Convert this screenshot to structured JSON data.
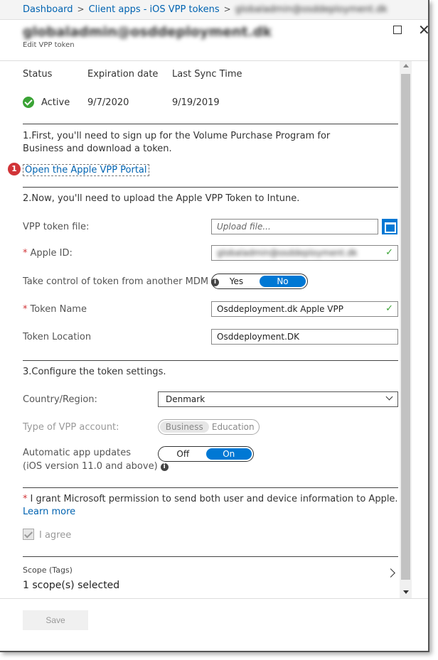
{
  "breadcrumb": {
    "items": [
      "Dashboard",
      "Client apps - iOS VPP tokens",
      "globaladmin@osddeployment.dk"
    ]
  },
  "header": {
    "title": "globaladmin@osddeployment.dk",
    "subtitle": "Edit VPP token"
  },
  "status_table": {
    "headers": [
      "Status",
      "Expiration date",
      "Last Sync Time"
    ],
    "status": "Active",
    "expiration": "9/7/2020",
    "last_sync": "9/19/2019"
  },
  "step1": {
    "text": "1.First, you'll need to sign up for the Volume Purchase Program for Business and download a token.",
    "badge": "1",
    "link": "Open the Apple VPP Portal"
  },
  "step2": {
    "text": "2.Now, you'll need to upload the Apple VPP Token to Intune.",
    "token_file_label": "VPP token file:",
    "token_file_placeholder": "Upload file...",
    "apple_id_label": "Apple ID:",
    "apple_id_value": "globaladmin@osddeployment.dk",
    "apple_id_visible_suffix": "dk",
    "take_control_label": "Take control of token from another MDM",
    "take_control_options": [
      "Yes",
      "No"
    ],
    "take_control_selected": "No",
    "token_name_label": "Token Name",
    "token_name_value": "Osddeployment.dk Apple VPP",
    "token_location_label": "Token Location",
    "token_location_value": "Osddeployment.DK"
  },
  "step3": {
    "text": "3.Configure the token settings.",
    "country_label": "Country/Region:",
    "country_value": "Denmark",
    "account_type_label": "Type of VPP account:",
    "account_type_options": [
      "Business",
      "Education"
    ],
    "account_type_selected": "Business",
    "auto_update_label": "Automatic app updates",
    "auto_update_sublabel": "(iOS version 11.0 and above)",
    "auto_update_options": [
      "Off",
      "On"
    ],
    "auto_update_selected": "On"
  },
  "consent": {
    "text": "I grant Microsoft permission to send both user and device information to Apple.",
    "learn_more": "Learn more",
    "agree_label": "I agree"
  },
  "scope": {
    "label": "Scope (Tags)",
    "value": "1 scope(s) selected"
  },
  "footer": {
    "save_label": "Save"
  },
  "colors": {
    "accent": "#0078d4",
    "link": "#0063b1",
    "success": "#3aa335",
    "required": "#d13438"
  }
}
